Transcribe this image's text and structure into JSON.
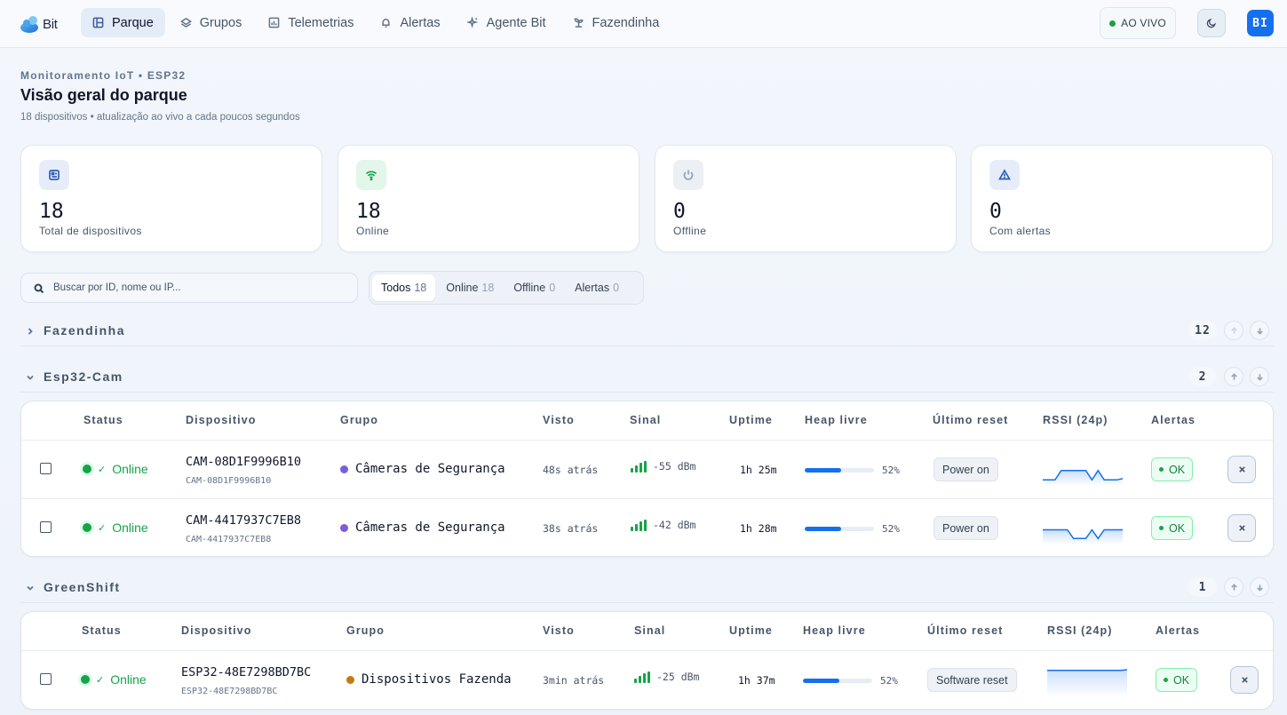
{
  "app": {
    "logo_text": "Bit"
  },
  "nav": [
    {
      "label": "Parque",
      "icon": "grid-icon",
      "active": true
    },
    {
      "label": "Grupos",
      "icon": "layers-icon",
      "active": false
    },
    {
      "label": "Telemetrias",
      "icon": "chart-icon",
      "active": false
    },
    {
      "label": "Alertas",
      "icon": "bell-icon",
      "active": false
    },
    {
      "label": "Agente Bit",
      "icon": "sparkle-icon",
      "active": false
    },
    {
      "label": "Fazendinha",
      "icon": "sprout-icon",
      "active": false
    }
  ],
  "topbar": {
    "live_label": "AO VIVO",
    "avatar_initials": "BI"
  },
  "header": {
    "eyebrow": "Monitoramento IoT • ESP32",
    "title": "Visão geral do parque",
    "subtitle": "18 dispositivos • atualização ao vivo a cada poucos segundos"
  },
  "stats": [
    {
      "value": "18",
      "label": "Total de dispositivos",
      "icon": "chip-icon",
      "bg": "#e6edf9",
      "stroke": "#2f5fb3"
    },
    {
      "value": "18",
      "label": "Online",
      "icon": "wifi-icon",
      "bg": "#e3f6ea",
      "stroke": "#16a34a"
    },
    {
      "value": "0",
      "label": "Offline",
      "icon": "power-icon",
      "bg": "#eceff3",
      "stroke": "#94a3b8"
    },
    {
      "value": "0",
      "label": "Com alertas",
      "icon": "warning-icon",
      "bg": "#e6edf9",
      "stroke": "#2f5fb3"
    }
  ],
  "search": {
    "placeholder": "Buscar por ID, nome ou IP..."
  },
  "filters": [
    {
      "label": "Todos",
      "count": "18",
      "active": true
    },
    {
      "label": "Online",
      "count": "18",
      "active": false
    },
    {
      "label": "Offline",
      "count": "0",
      "active": false
    },
    {
      "label": "Alertas",
      "count": "0",
      "active": false
    }
  ],
  "columns": [
    "Status",
    "Dispositivo",
    "Grupo",
    "Visto",
    "Sinal",
    "Uptime",
    "Heap livre",
    "Último reset",
    "RSSI (24p)",
    "Alertas"
  ],
  "groups": [
    {
      "name": "Fazendinha",
      "count": "12",
      "expanded": false
    },
    {
      "name": "Esp32-Cam",
      "count": "2",
      "expanded": true,
      "rows": [
        {
          "status": "Online",
          "name": "CAM-08D1F9996B10",
          "id": "CAM-08D1F9996B10",
          "group": "Câmeras de Segurança",
          "group_color": "#7c5cdb",
          "seen": "48s atrás",
          "signal_bars": 4,
          "signal": "-55 dBm",
          "uptime": "1h 25m",
          "heap_fraction": 0.52,
          "heap": "52%",
          "reset": "Power on",
          "rssi_24p": [
            -55,
            -55,
            -55,
            -41,
            -41,
            -41,
            -41,
            -41,
            -55,
            -41,
            -55,
            -55,
            -55,
            -53
          ],
          "alert": "OK"
        },
        {
          "status": "Online",
          "name": "CAM-4417937C7EB8",
          "id": "CAM-4417937C7EB8",
          "group": "Câmeras de Segurança",
          "group_color": "#7c5cdb",
          "seen": "38s atrás",
          "signal_bars": 4,
          "signal": "-42 dBm",
          "uptime": "1h 28m",
          "heap_fraction": 0.52,
          "heap": "52%",
          "reset": "Power on",
          "rssi_24p": [
            -42,
            -42,
            -42,
            -42,
            -42,
            -55,
            -55,
            -55,
            -42,
            -55,
            -42,
            -42,
            -42,
            -42
          ],
          "alert": "OK"
        }
      ]
    },
    {
      "name": "GreenShift",
      "count": "1",
      "expanded": true,
      "rows": [
        {
          "status": "Online",
          "name": "ESP32-48E7298BD7BC",
          "id": "ESP32-48E7298BD7BC",
          "group": "Dispositivos Fazenda",
          "group_color": "#c47a0e",
          "seen": "3min atrás",
          "signal_bars": 4,
          "signal": "-25 dBm",
          "uptime": "1h 37m",
          "heap_fraction": 0.52,
          "heap": "52%",
          "reset": "Software reset",
          "rssi_24p": [
            -25,
            -25,
            -25,
            -25,
            -25,
            -25,
            -25,
            -25,
            -25,
            -25,
            -25,
            -25,
            -25,
            -24
          ],
          "alert": "OK"
        }
      ]
    }
  ]
}
